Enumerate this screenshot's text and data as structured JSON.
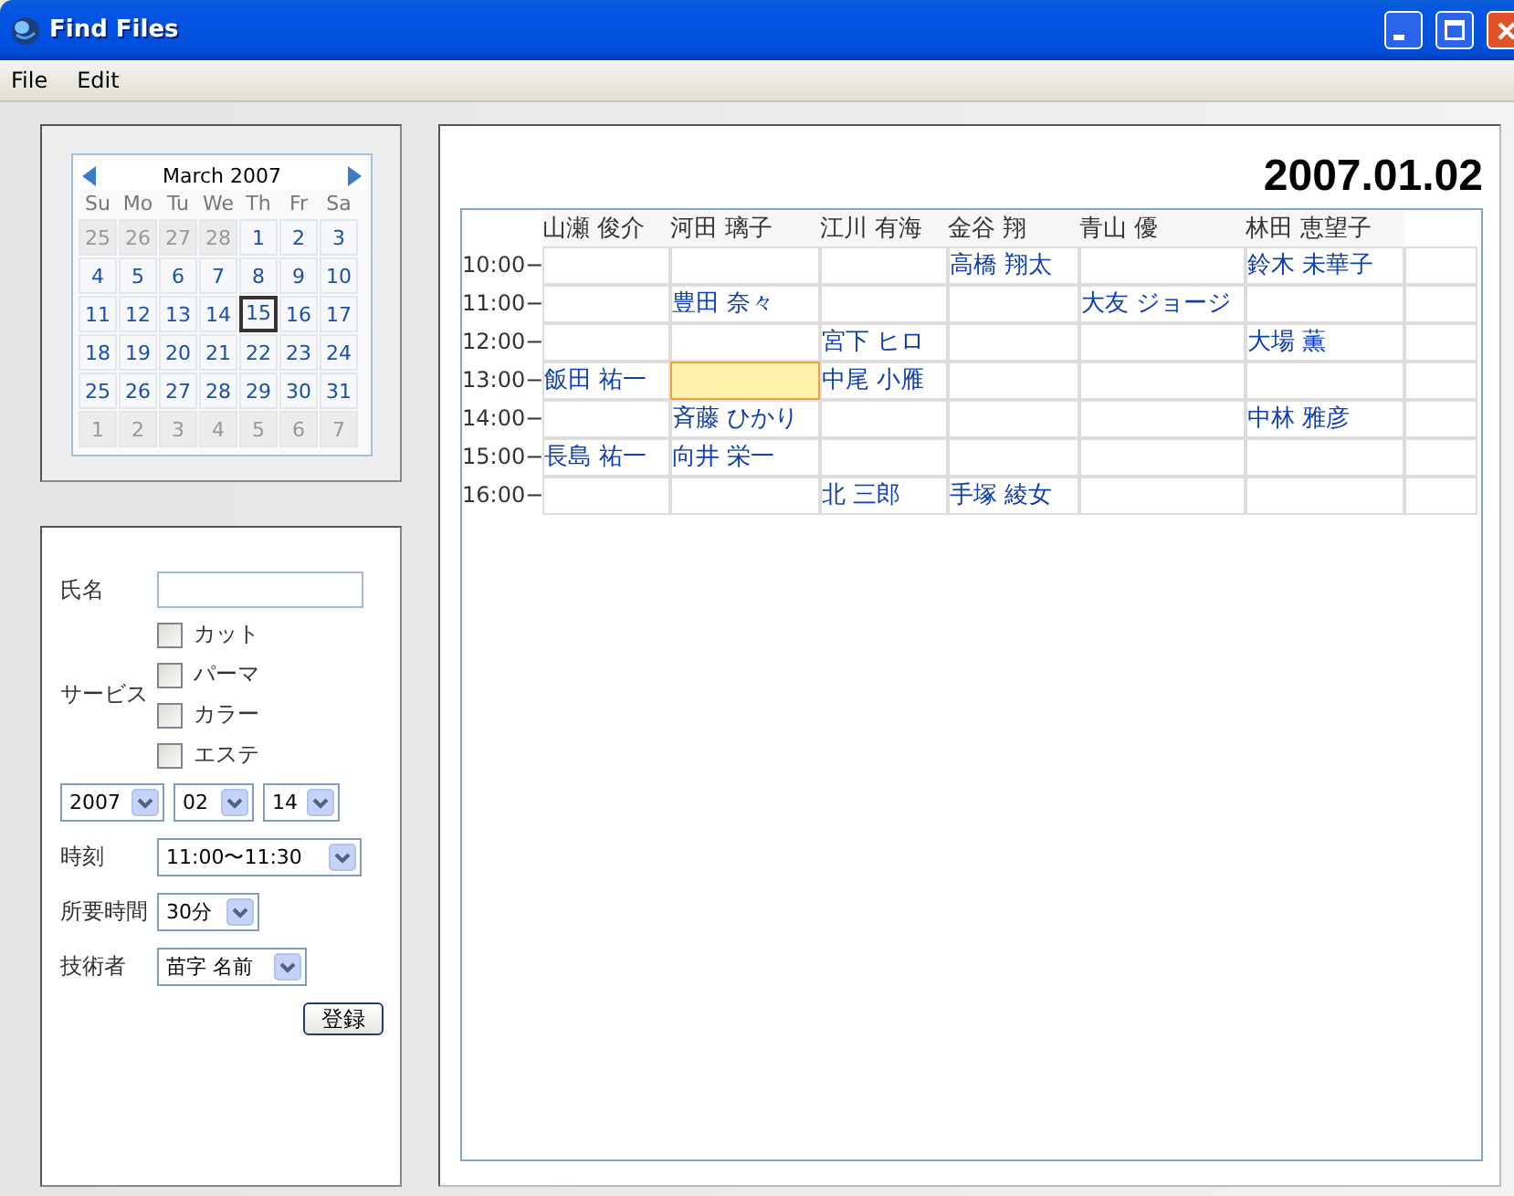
{
  "window": {
    "title": "Find Files"
  },
  "menu": [
    "File",
    "Edit"
  ],
  "calendar": {
    "month": "March 2007",
    "weekdays": [
      "Su",
      "Mo",
      "Tu",
      "We",
      "Th",
      "Fr",
      "Sa"
    ],
    "weeks": [
      [
        {
          "day": "25",
          "other_month": true,
          "selected": false
        },
        {
          "day": "26",
          "other_month": true,
          "selected": false
        },
        {
          "day": "27",
          "other_month": true,
          "selected": false
        },
        {
          "day": "28",
          "other_month": true,
          "selected": false
        },
        {
          "day": "1",
          "other_month": false,
          "selected": false
        },
        {
          "day": "2",
          "other_month": false,
          "selected": false
        },
        {
          "day": "3",
          "other_month": false,
          "selected": false
        }
      ],
      [
        {
          "day": "4",
          "other_month": false,
          "selected": false
        },
        {
          "day": "5",
          "other_month": false,
          "selected": false
        },
        {
          "day": "6",
          "other_month": false,
          "selected": false
        },
        {
          "day": "7",
          "other_month": false,
          "selected": false
        },
        {
          "day": "8",
          "other_month": false,
          "selected": false
        },
        {
          "day": "9",
          "other_month": false,
          "selected": false
        },
        {
          "day": "10",
          "other_month": false,
          "selected": false
        }
      ],
      [
        {
          "day": "11",
          "other_month": false,
          "selected": false
        },
        {
          "day": "12",
          "other_month": false,
          "selected": false
        },
        {
          "day": "13",
          "other_month": false,
          "selected": false
        },
        {
          "day": "14",
          "other_month": false,
          "selected": false
        },
        {
          "day": "15",
          "other_month": false,
          "selected": true
        },
        {
          "day": "16",
          "other_month": false,
          "selected": false
        },
        {
          "day": "17",
          "other_month": false,
          "selected": false
        }
      ],
      [
        {
          "day": "18",
          "other_month": false,
          "selected": false
        },
        {
          "day": "19",
          "other_month": false,
          "selected": false
        },
        {
          "day": "20",
          "other_month": false,
          "selected": false
        },
        {
          "day": "21",
          "other_month": false,
          "selected": false
        },
        {
          "day": "22",
          "other_month": false,
          "selected": false
        },
        {
          "day": "23",
          "other_month": false,
          "selected": false
        },
        {
          "day": "24",
          "other_month": false,
          "selected": false
        }
      ],
      [
        {
          "day": "25",
          "other_month": false,
          "selected": false
        },
        {
          "day": "26",
          "other_month": false,
          "selected": false
        },
        {
          "day": "27",
          "other_month": false,
          "selected": false
        },
        {
          "day": "28",
          "other_month": false,
          "selected": false
        },
        {
          "day": "29",
          "other_month": false,
          "selected": false
        },
        {
          "day": "30",
          "other_month": false,
          "selected": false
        },
        {
          "day": "31",
          "other_month": false,
          "selected": false
        }
      ],
      [
        {
          "day": "1",
          "other_month": true,
          "selected": false
        },
        {
          "day": "2",
          "other_month": true,
          "selected": false
        },
        {
          "day": "3",
          "other_month": true,
          "selected": false
        },
        {
          "day": "4",
          "other_month": true,
          "selected": false
        },
        {
          "day": "5",
          "other_month": true,
          "selected": false
        },
        {
          "day": "6",
          "other_month": true,
          "selected": false
        },
        {
          "day": "7",
          "other_month": true,
          "selected": false
        }
      ]
    ]
  },
  "form": {
    "name_label": "氏名",
    "service_label": "サービス",
    "services": [
      {
        "label": "カット",
        "checked": false
      },
      {
        "label": "パーマ",
        "checked": false
      },
      {
        "label": "カラー",
        "checked": false
      },
      {
        "label": "エステ",
        "checked": false
      }
    ],
    "date_selects": [
      "2007",
      "02",
      "14"
    ],
    "fields": [
      {
        "label": "時刻",
        "value": "11:00〜11:30"
      },
      {
        "label": "所要時間",
        "value": "30分"
      },
      {
        "label": "技術者",
        "value": "苗字 名前"
      }
    ],
    "submit": "登録"
  },
  "schedule": {
    "date": "2007.01.02",
    "columns": [
      "山瀬 俊介",
      "河田 璃子",
      "江川 有海",
      "金谷 翔",
      "青山 優",
      "林田 恵望子"
    ],
    "rows": [
      {
        "time": "10:00−",
        "cells": [
          {
            "selected": false
          },
          {
            "selected": false
          },
          {
            "selected": false
          },
          {
            "text": "高橋 翔太",
            "selected": false
          },
          {
            "selected": false
          },
          {
            "text": "鈴木 未華子",
            "selected": false
          },
          {
            "selected": false
          }
        ]
      },
      {
        "time": "11:00−",
        "cells": [
          {
            "selected": false
          },
          {
            "text": "豊田 奈々",
            "selected": false
          },
          {
            "selected": false
          },
          {
            "selected": false
          },
          {
            "text": "大友 ジョージ",
            "selected": false
          },
          {
            "selected": false
          },
          {
            "selected": false
          }
        ]
      },
      {
        "time": "12:00−",
        "cells": [
          {
            "selected": false
          },
          {
            "selected": false
          },
          {
            "text": "宮下 ヒロ",
            "selected": false
          },
          {
            "selected": false
          },
          {
            "selected": false
          },
          {
            "text": "大場 薫",
            "selected": false
          },
          {
            "selected": false
          }
        ]
      },
      {
        "time": "13:00−",
        "cells": [
          {
            "text": "飯田 祐一",
            "selected": false
          },
          {
            "selected": true
          },
          {
            "text": "中尾 小雁",
            "selected": false
          },
          {
            "selected": false
          },
          {
            "selected": false
          },
          {
            "selected": false
          },
          {
            "selected": false
          }
        ]
      },
      {
        "time": "14:00−",
        "cells": [
          {
            "selected": false
          },
          {
            "text": "斉藤 ひかり",
            "selected": false
          },
          {
            "selected": false
          },
          {
            "selected": false
          },
          {
            "selected": false
          },
          {
            "text": "中林 雅彦",
            "selected": false
          },
          {
            "selected": false
          }
        ]
      },
      {
        "time": "15:00−",
        "cells": [
          {
            "text": "長島 祐一",
            "selected": false
          },
          {
            "text": "向井 栄一",
            "selected": false
          },
          {
            "selected": false
          },
          {
            "selected": false
          },
          {
            "selected": false
          },
          {
            "selected": false
          },
          {
            "selected": false
          }
        ]
      },
      {
        "time": "16:00−",
        "cells": [
          {
            "selected": false
          },
          {
            "selected": false
          },
          {
            "text": "北 三郎",
            "selected": false
          },
          {
            "text": "手塚 綾女",
            "selected": false
          },
          {
            "selected": false
          },
          {
            "selected": false
          },
          {
            "selected": false
          }
        ]
      }
    ]
  }
}
